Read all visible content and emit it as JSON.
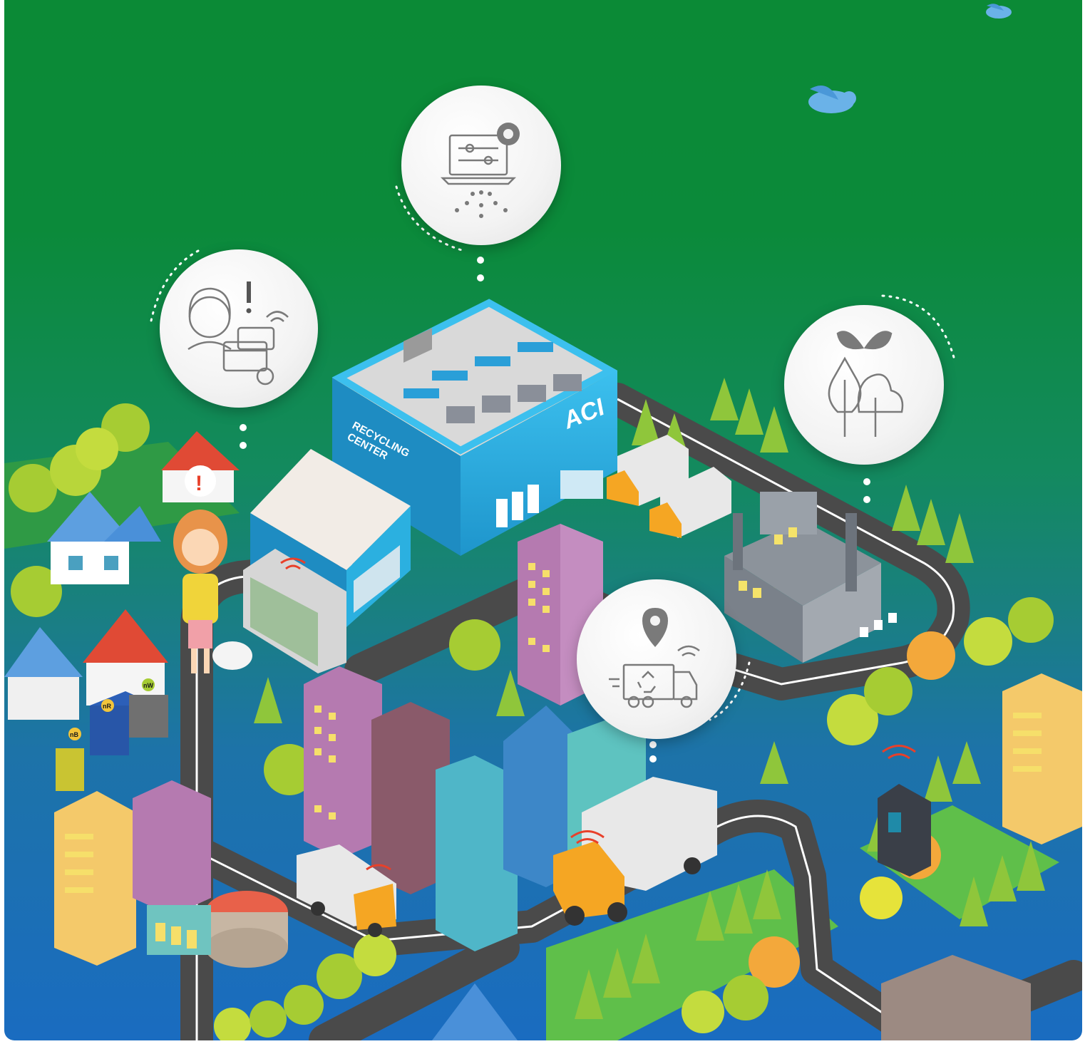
{
  "scene": {
    "building_signs": {
      "recycling_center_line1": "RECYCLING",
      "recycling_center_line2": "CENTER",
      "brand": "ACI"
    },
    "bin_tags": [
      "nB",
      "nR",
      "nW"
    ],
    "alert_symbol": "!"
  },
  "feature_circles": [
    {
      "id": "customer-alert",
      "icon": "customer-payment-alert-icon"
    },
    {
      "id": "system-control",
      "icon": "laptop-settings-icon"
    },
    {
      "id": "eco-environment",
      "icon": "leaf-trees-icon"
    },
    {
      "id": "truck-tracking",
      "icon": "gps-recycling-truck-icon"
    }
  ],
  "colors": {
    "sky_top": "#0b8a36",
    "ground_bottom": "#1a6cc0",
    "building_blue": "#2bb0e0",
    "truck_orange": "#f5a623",
    "signal_red": "#e8402a",
    "road": "#4a4a4a",
    "tree_green": "#a6cc33"
  }
}
